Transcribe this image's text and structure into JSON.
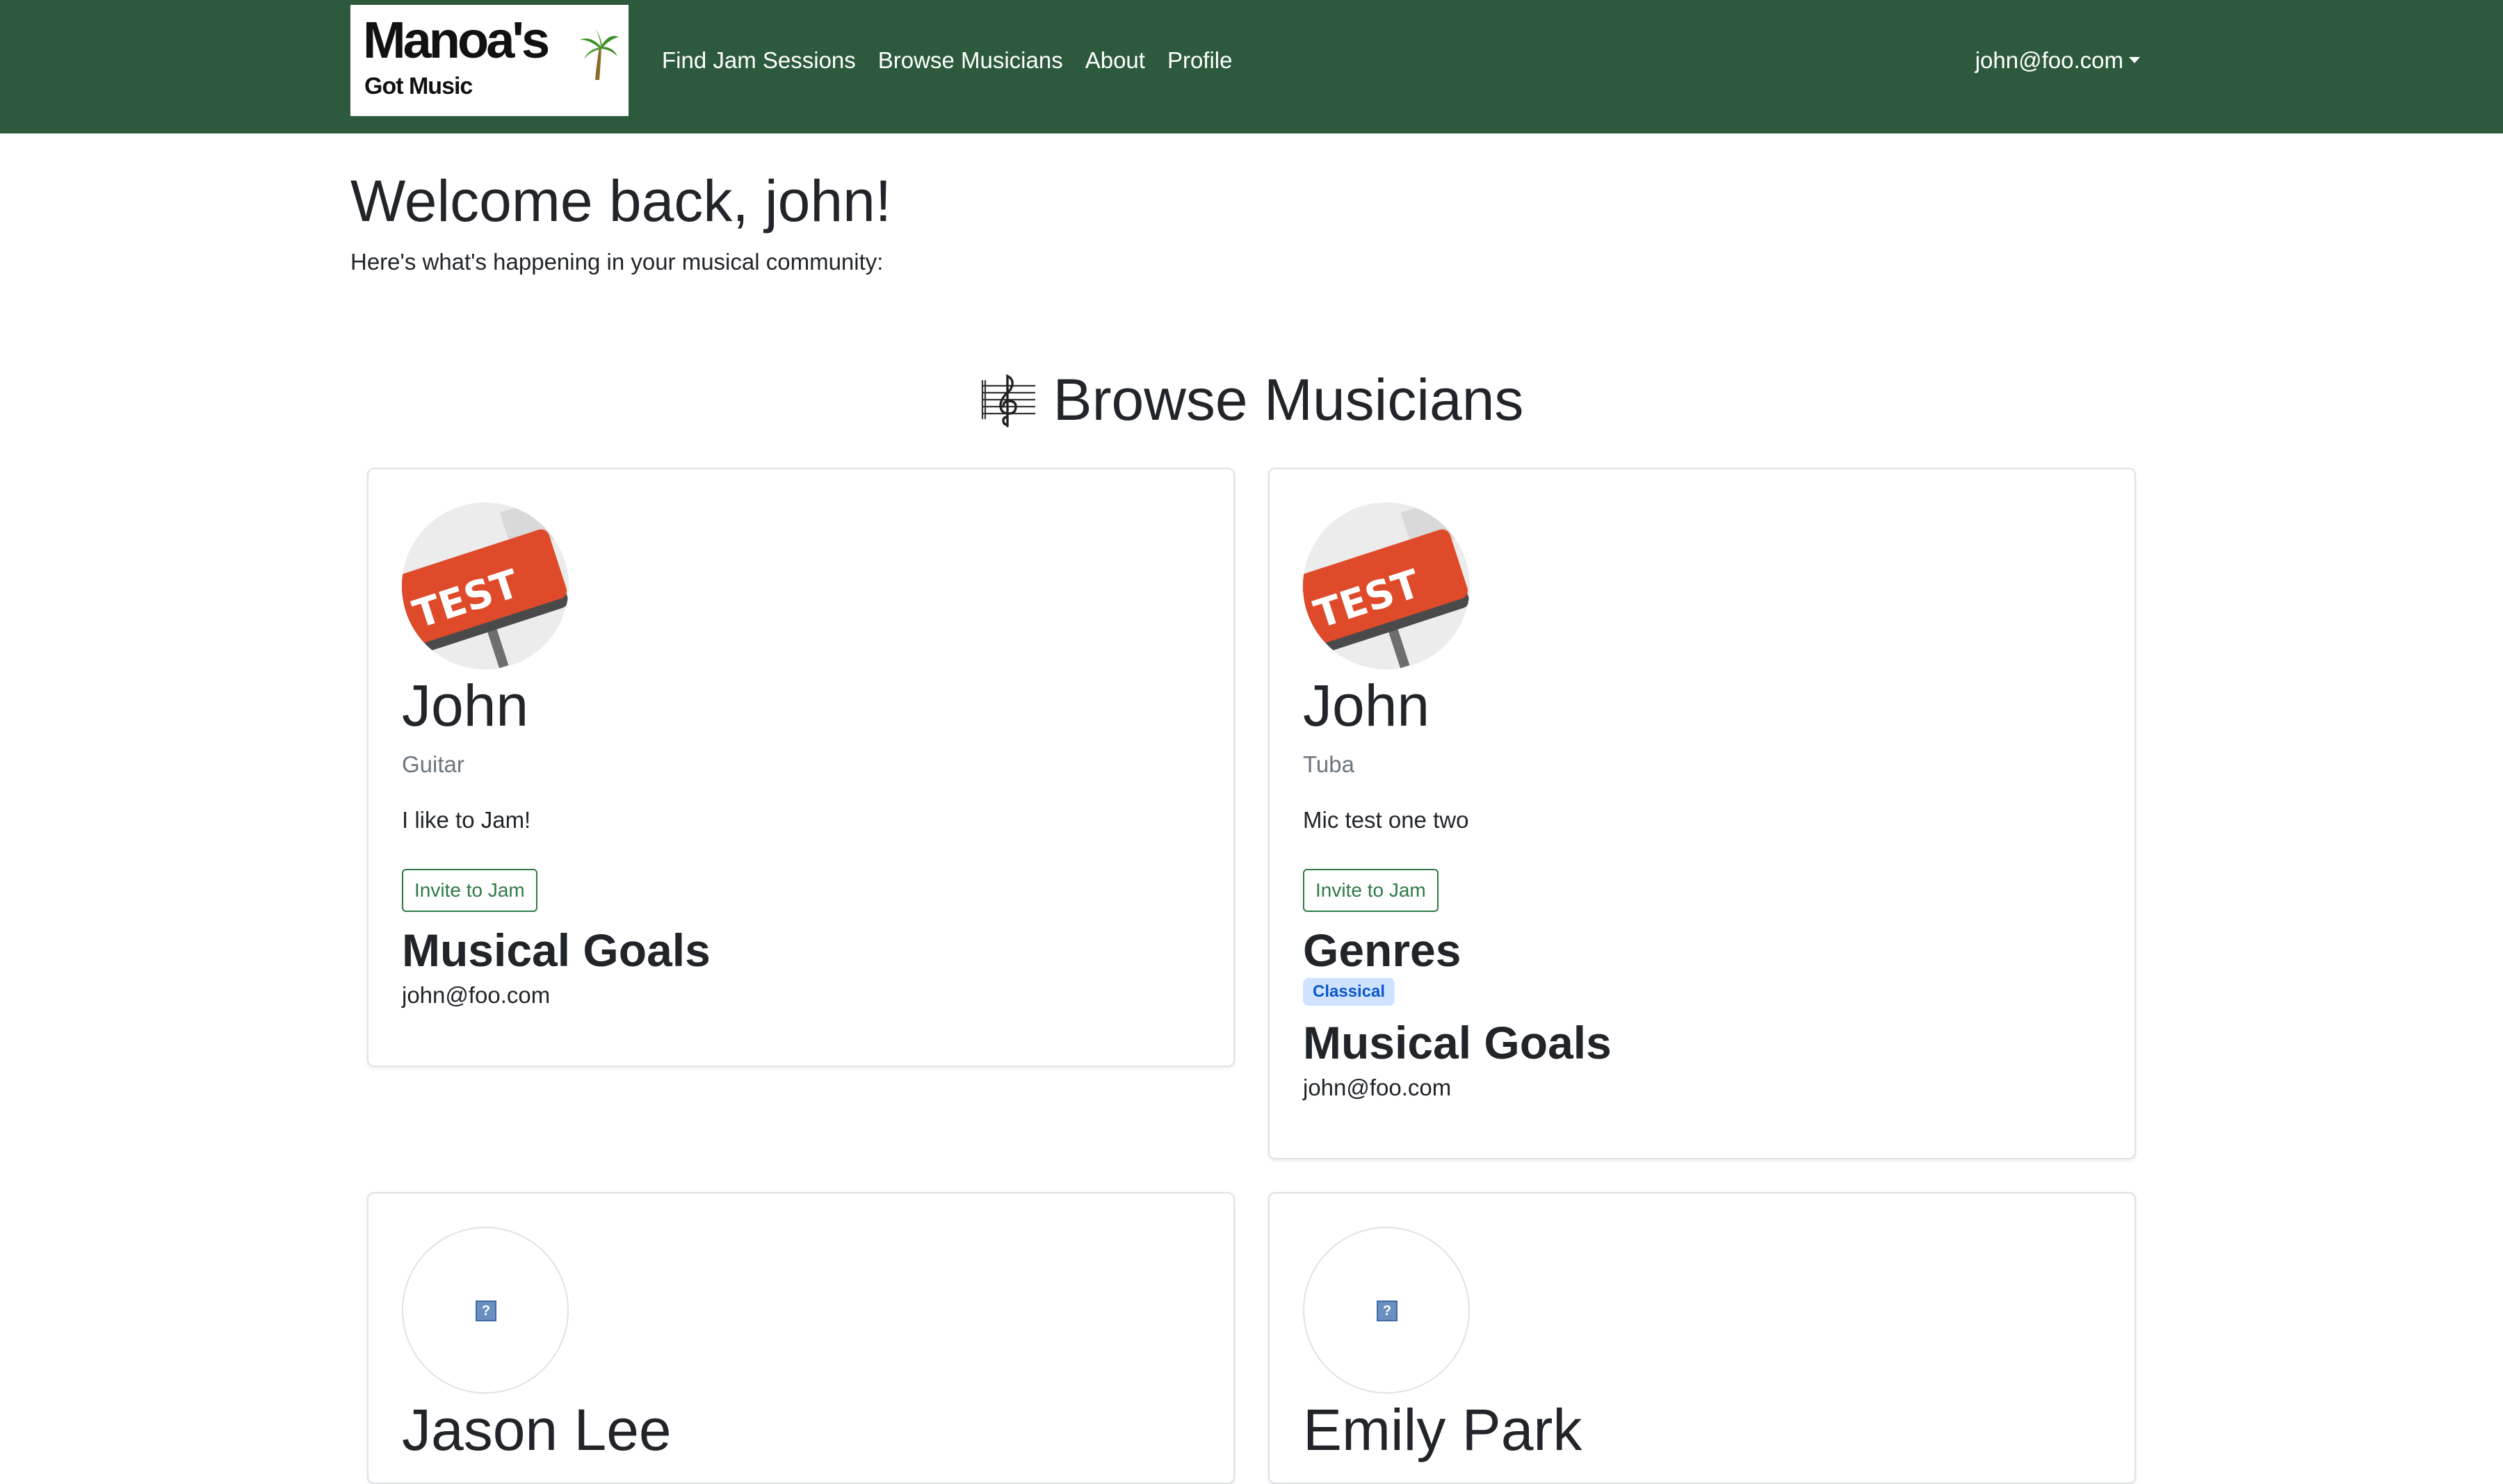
{
  "navbar": {
    "logo": {
      "line1": "Manoa's",
      "line2": "Got Music"
    },
    "links": [
      "Find Jam Sessions",
      "Browse Musicians",
      "About",
      "Profile"
    ],
    "user_email": "john@foo.com",
    "background_color": "#2d5a3d"
  },
  "welcome": {
    "title": "Welcome back, john!",
    "subtitle": "Here's what's happening in your musical community:"
  },
  "browse": {
    "icon": "music-staff-icon",
    "title": "Browse Musicians"
  },
  "musicians": [
    {
      "avatar": "test-key-photo",
      "name": "John",
      "instrument": "Guitar",
      "bio": "I like to Jam!",
      "invite_label": "Invite to Jam",
      "genres_heading": "",
      "genres": [],
      "goals_heading": "Musical Goals",
      "email": "john@foo.com"
    },
    {
      "avatar": "test-key-photo",
      "name": "John",
      "instrument": "Tuba",
      "bio": "Mic test one two",
      "invite_label": "Invite to Jam",
      "genres_heading": "Genres",
      "genres": [
        "Classical"
      ],
      "goals_heading": "Musical Goals",
      "email": "john@foo.com"
    },
    {
      "avatar": "broken-image",
      "name": "Jason Lee"
    },
    {
      "avatar": "broken-image",
      "name": "Emily Park"
    }
  ],
  "colors": {
    "accent_green": "#2d7a46",
    "badge_bg": "#cfe2ff",
    "badge_text": "#0a58ca"
  }
}
